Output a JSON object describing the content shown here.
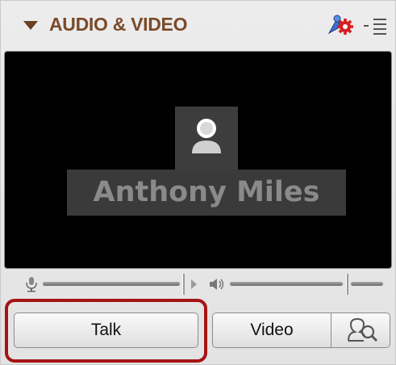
{
  "panel": {
    "title": "AUDIO & VIDEO",
    "icons": {
      "collapse": "triangle-down-icon",
      "settings": "settings-gear-icon",
      "menu": "panel-menu-icon"
    }
  },
  "video": {
    "participant_name": "Anthony Miles",
    "avatar_icon": "user-silhouette-icon"
  },
  "volume": {
    "microphone_icon": "microphone-icon",
    "speaker_icon": "speaker-icon",
    "microphone_level": 1.0,
    "speaker_level": 1.0
  },
  "buttons": {
    "talk_label": "Talk",
    "video_label": "Video",
    "preview_icon": "video-preview-icon"
  },
  "colors": {
    "title": "#7a4a2a",
    "highlight": "#a51414",
    "video_background": "#000000"
  }
}
